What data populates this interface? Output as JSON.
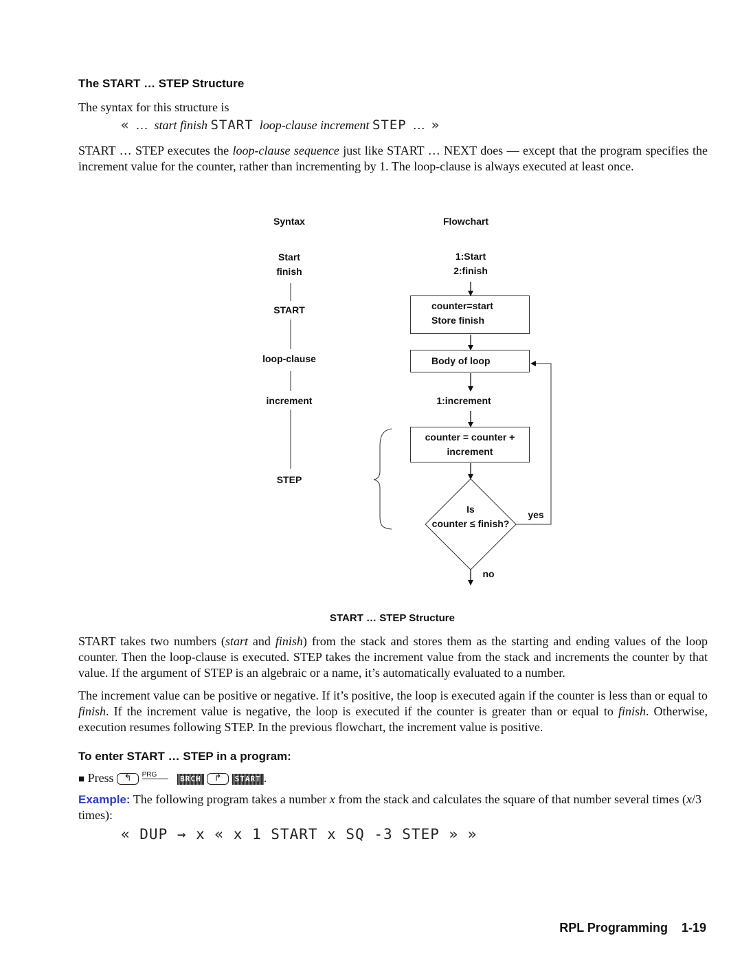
{
  "section": {
    "title": "The START … STEP Structure",
    "syntax_intro": "The syntax for this structure is",
    "syntax_line": {
      "open": "«",
      "ellipsis1": "…",
      "args": "start finish",
      "kw_start": "START",
      "clause": "loop-clause increment",
      "kw_step": "STEP",
      "ellipsis2": "…",
      "close": "»"
    },
    "para1": {
      "part1": "START … STEP executes the ",
      "italic": "loop-clause sequence",
      "part2": " just like START … NEXT does — except that the program specifies the increment value for the counter, rather than incrementing by 1. The loop-clause is always executed at least once."
    }
  },
  "diagram": {
    "syntax_header": "Syntax",
    "flowchart_header": "Flowchart",
    "syntax_items": [
      "Start",
      "finish",
      "START",
      "loop-clause",
      "increment",
      "STEP"
    ],
    "flow": {
      "stack_in_1": "1:Start",
      "stack_in_2": "2:finish",
      "box_init_1": "counter=start",
      "box_init_2": "Store finish",
      "box_body": "Body of loop",
      "stack_inc": "1:increment",
      "box_update_1": "counter = counter +",
      "box_update_2": "increment",
      "decision_1": "Is",
      "decision_2": "counter ≤ finish?",
      "yes_label": "yes",
      "no_label": "no"
    },
    "caption": "START … STEP Structure"
  },
  "para2": {
    "p1": "START takes two numbers (",
    "i1": "start",
    "p2": " and ",
    "i2": "finish",
    "p3": ") from the stack and stores them as the starting and ending values of the loop counter. Then the loop-clause is executed. STEP takes the increment value from the stack and increments the counter by that value. If the argument of STEP is an algebraic or a name, it’s automatically evaluated to a number."
  },
  "para3": {
    "p1": "The increment value can be positive or negative. If it’s positive, the loop is executed again if the counter is less than or equal to ",
    "i1": "finish",
    "p2": ". If the increment value is negative, the loop is executed if the counter is greater than or equal to ",
    "i2": "finish",
    "p3": ". Otherwise, execution resumes following STEP. In the previous flowchart, the increment value is positive."
  },
  "procedure": {
    "title": "To enter START … STEP in a program:",
    "bullet": "■",
    "press": "Press",
    "left_shift_key": "↰",
    "prg_label": "PRG",
    "menu_brch": "BRCH",
    "right_shift_key": "↱",
    "menu_start": "START",
    "period": "."
  },
  "example": {
    "label": "Example:",
    "p1": " The following program takes a number ",
    "x1": "x",
    "p2": " from the stack and calculates the square of that number several times (",
    "x2": "x",
    "p3": "/3 times):",
    "code": "« DUP → x « x 1 START x SQ -3 STEP » »"
  },
  "footer": {
    "chapter": "RPL Programming",
    "page": "1-19"
  }
}
